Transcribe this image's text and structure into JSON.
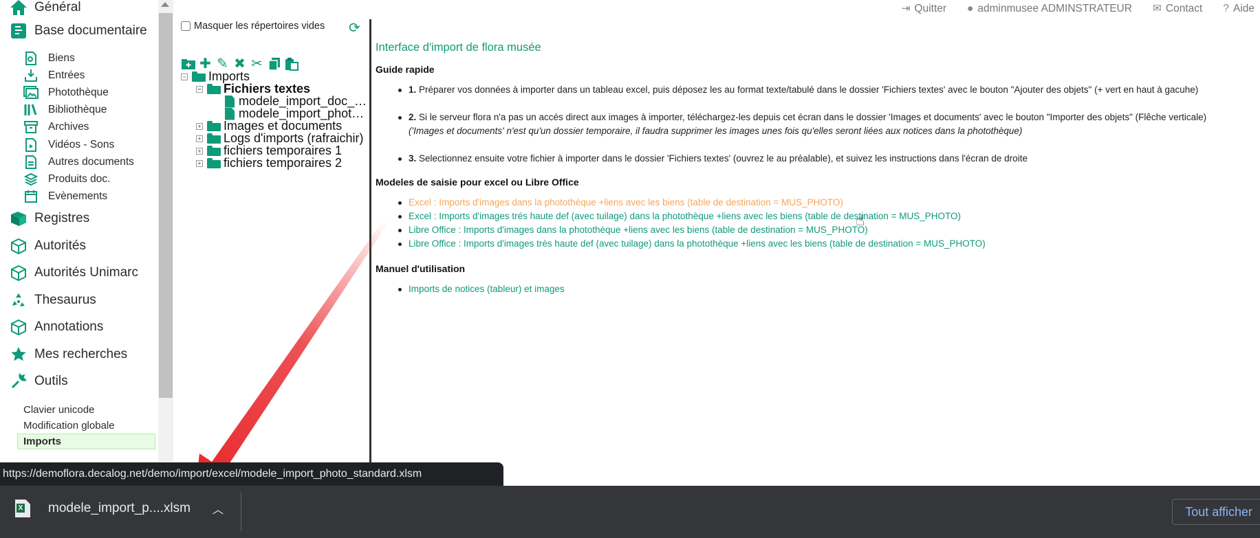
{
  "sidebar": {
    "general": "Général",
    "base_doc": "Base documentaire",
    "sub_items": [
      "Biens",
      "Entrées",
      "Photothèque",
      "Bibliothèque",
      "Archives",
      "Vidéos - Sons",
      "Autres documents",
      "Produits doc.",
      "Evènements"
    ],
    "registres": "Registres",
    "autorites": "Autorités",
    "autorites_unimarc": "Autorités Unimarc",
    "thesaurus": "Thesaurus",
    "annotations": "Annotations",
    "mes_recherches": "Mes recherches",
    "outils": "Outils",
    "tools": [
      "Clavier unicode",
      "Modification globale",
      "Imports"
    ]
  },
  "tree": {
    "hide_empty_label": "Masquer les répertoires vides",
    "root": "Imports",
    "fichiers_textes": "Fichiers textes",
    "file1": "modele_import_doc_…",
    "file2": "modele_import_phot…",
    "images_docs": "Images et documents",
    "logs": "Logs d'imports (rafraichir)",
    "tmp1": "fichiers temporaires 1",
    "tmp2": "fichiers temporaires 2"
  },
  "header": {
    "quit": "Quitter",
    "user": "adminmusee ADMINSTRATEUR",
    "contact": "Contact",
    "help": "Aide"
  },
  "main": {
    "title": "Interface d'import de flora musée",
    "guide_heading": "Guide rapide",
    "step1_num": "1.",
    "step1": "Préparer vos données à importer dans un tableau excel, puis déposez les au format texte/tabulé dans le dossier 'Fichiers textes' avec le bouton \"Ajouter des objets\" (+ vert en haut à gacuhe)",
    "step2_num": "2.",
    "step2": "Si le serveur flora n'a pas un accés direct aux images à importer, téléchargez-les depuis cet écran dans le dossier 'Images et documents' avec le bouton \"Importer des objets\" (Flêche verticale)",
    "step2_note": "('Images et documents' n'est qu'un dossier temporaire, il faudra supprimer les images unes fois qu'elles seront liées aux notices dans la photothèque)",
    "step3_num": "3.",
    "step3": "Selectionnez ensuite votre fichier à importer dans le dossier 'Fichiers textes' (ouvrez le au préalable), et suivez les instructions dans l'écran de droite",
    "models_heading": "Modeles de saisie pour excel ou Libre Office",
    "models": [
      "Excel : Imports d'images dans la photothèque +liens avec les biens (table de destination = MUS_PHOTO)",
      "Excel : Imports d'images trés haute def (avec tuilage) dans la photothèque +liens avec les biens (table de destination = MUS_PHOTO)",
      "Libre Office : Imports d'images dans la photothèque +liens avec les biens (table de destination = MUS_PHOTO)",
      "Libre Office : Imports d'images trés haute def (avec tuilage) dans la photothèque +liens avec les biens (table de destination = MUS_PHOTO)"
    ],
    "manual_heading": "Manuel d'utilisation",
    "manual_link": "Imports de notices (tableur) et images"
  },
  "status_url": "https://demoflora.decalog.net/demo/import/excel/modele_import_photo_standard.xlsm",
  "download": {
    "filename": "modele_import_p....xlsm",
    "show_all": "Tout afficher"
  },
  "colors": {
    "accent": "#0f9a7a",
    "hover_link": "#f4a65a",
    "arrow": "#e8262a"
  }
}
